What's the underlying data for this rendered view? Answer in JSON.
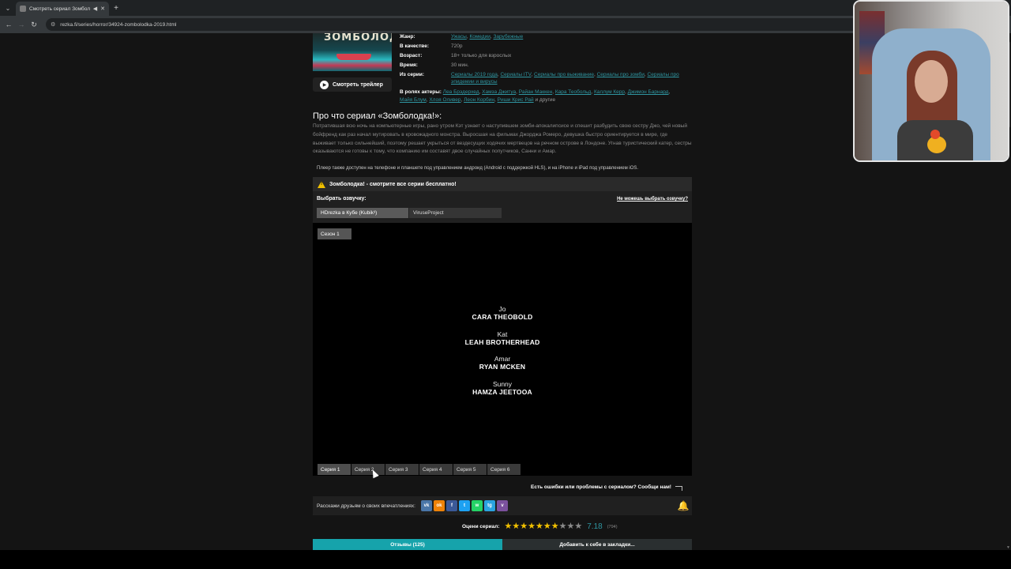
{
  "browser": {
    "tab_title": "Смотреть сериал Зомбол...",
    "url": "rezka.fi/series/horror/34924-zombolodka-2019.html"
  },
  "poster": {
    "title_text": "ЗОМБОЛОДКА!"
  },
  "trailer_label": "Смотреть трейлер",
  "info": {
    "genre_key": "Жанр:",
    "genres": [
      "Ужасы",
      "Комедии",
      "Зарубежные"
    ],
    "quality_key": "В качестве:",
    "quality": "720p",
    "age_key": "Возраст:",
    "age": "18+ только для взрослых",
    "time_key": "Время:",
    "time": "30 мин.",
    "series_key": "Из серии:",
    "series": [
      "Сериалы 2019 года",
      "Сериалы ITV",
      "Сериалы про выживание",
      "Сериалы про зомби",
      "Сериалы про эпидемии и вирусы"
    ],
    "cast_key": "В ролях актеры:",
    "cast": [
      "Леа Брэдерхед",
      "Хамза Джитуа",
      "Райан Маккен",
      "Кара Теобольд",
      "Каллум Керр",
      "Джимон Барнард",
      "Майя Блум",
      "Хлоя Оливер",
      "Леон Корбин",
      "Риши Крис Рай"
    ],
    "cast_more": "и другие"
  },
  "about": {
    "title": "Про что сериал «Зомболодка!»:",
    "text": "Потратившая всю ночь на компьютерные игры, рано утром Кэт узнает о наступившем зомби-апокалипсисе и спешит разбудить свою сестру Джо, чей новый бойфренд как раз начал мутировать в кровожадного монстра. Выросшая на фильмах Джорджа Ромеро, девушка быстро ориентируется в мире, где выживает только сильнейший, поэтому решает укрыться от вездесущих ходячих мертвецов на речном острове в Лондоне. Угнав туристический катер, сестры оказываются не готовы к тому, что компанию им составят двое случайных попутчиков, Санни и Амар."
  },
  "player_note": "Плеер также доступен на телефоне и планшете под управлением андроид (Android с поддержкой HLS), и на iPhone и iPad под управлением iOS.",
  "warning": "Зомболодка! - смотрите все серии бесплатно!",
  "voice": {
    "label": "Выбрать озвучку:",
    "help": "Не можешь выбрать озвучку?",
    "options": [
      "HDrezka в Кубе (Kubik³)",
      "ViruseProject"
    ]
  },
  "season_label": "Сезон 1",
  "credits": [
    {
      "role": "Jo",
      "name": "CARA THEOBOLD"
    },
    {
      "role": "Kat",
      "name": "LEAH BROTHERHEAD"
    },
    {
      "role": "Amar",
      "name": "RYAN MCKEN"
    },
    {
      "role": "Sunny",
      "name": "HAMZA JEETOOA"
    }
  ],
  "episodes": [
    "Серия 1",
    "Серия 2",
    "Серия 3",
    "Серия 4",
    "Серия 5",
    "Серия 6"
  ],
  "report": "Есть ошибки или проблемы с сериалом? Сообщи нам!",
  "share": {
    "label": "Расскажи друзьям о своих впечатлениях:",
    "icons": [
      {
        "name": "vk-icon",
        "glyph": "vk",
        "color": "#4a76a8"
      },
      {
        "name": "ok-icon",
        "glyph": "ok",
        "color": "#ee8208"
      },
      {
        "name": "facebook-icon",
        "glyph": "f",
        "color": "#3b5998"
      },
      {
        "name": "twitter-icon",
        "glyph": "t",
        "color": "#1da1f2"
      },
      {
        "name": "whatsapp-icon",
        "glyph": "w",
        "color": "#25d366"
      },
      {
        "name": "telegram-icon",
        "glyph": "tg",
        "color": "#2aa3df"
      },
      {
        "name": "viber-icon",
        "glyph": "v",
        "color": "#7b519d"
      }
    ]
  },
  "rating": {
    "label": "Оцени сериал:",
    "value": "7.18",
    "count": "(794)",
    "stars_total": 10,
    "stars_filled": 7
  },
  "buttons": {
    "reviews": "Отзывы (125)",
    "bookmark": "Добавить к себе в закладки..."
  },
  "colors": {
    "accent": "#16a3ab",
    "link": "#2f95a0",
    "star_filled": "#f2c100",
    "star_empty": "#8a8a8a"
  }
}
